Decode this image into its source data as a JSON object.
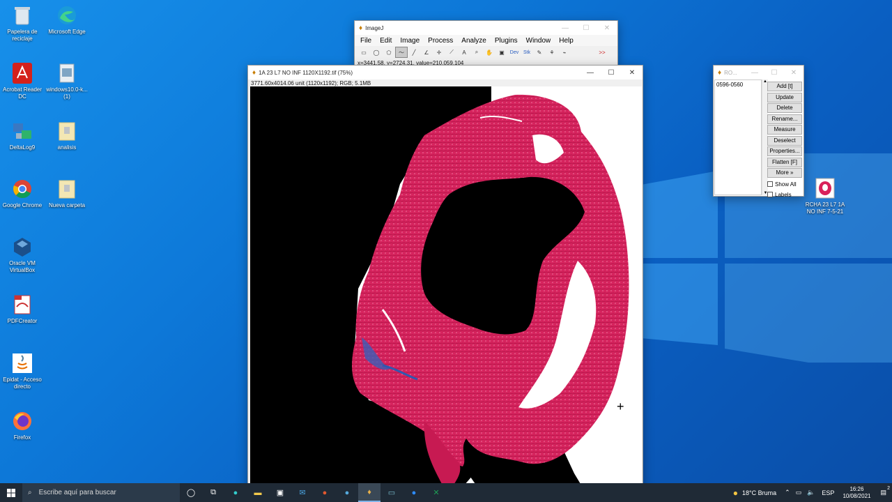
{
  "desktop": {
    "icons": [
      {
        "label": "Papelera de reciclaje",
        "icon": "recycle-bin-icon"
      },
      {
        "label": "Microsoft Edge",
        "icon": "edge-icon"
      },
      {
        "label": "Acrobat Reader DC",
        "icon": "acrobat-icon"
      },
      {
        "label": "windows10.0-k...(1)",
        "icon": "installer-icon"
      },
      {
        "label": "DeltaLog9",
        "icon": "deltalog-icon"
      },
      {
        "label": "analisis",
        "icon": "folder-icon"
      },
      {
        "label": "Google Chrome",
        "icon": "chrome-icon"
      },
      {
        "label": "Nueva carpeta",
        "icon": "folder-icon"
      },
      {
        "label": "Oracle VM VirtualBox",
        "icon": "virtualbox-icon"
      },
      {
        "label": "PDFCreator",
        "icon": "pdfcreator-icon"
      },
      {
        "label": "Epidat - Acceso directo",
        "icon": "java-icon"
      },
      {
        "label": "Firefox",
        "icon": "firefox-icon"
      },
      {
        "label": "RCHA 23 L7 1A NO INF 7-5-21",
        "icon": "tiff-image-icon"
      }
    ]
  },
  "imagej": {
    "title": "ImageJ",
    "menu": [
      "File",
      "Edit",
      "Image",
      "Process",
      "Analyze",
      "Plugins",
      "Window",
      "Help"
    ],
    "tools": [
      "rectangle-tool",
      "oval-tool",
      "polygon-tool",
      "freehand-tool",
      "line-tool",
      "angle-tool",
      "point-tool",
      "wand-tool",
      "text-tool",
      "magnifier-tool",
      "hand-tool",
      "color-picker-tool",
      "Dev",
      "Stk",
      "pencil-tool",
      "brush-tool",
      "flood-fill-tool",
      "more-tools"
    ],
    "tool_labels": {
      "dev": "Dev",
      "stk": "Stk",
      "more": ">>"
    },
    "status": "x=3441.58, y=2724.31, value=210,059,104"
  },
  "image_window": {
    "title": "1A 23 L7 NO INF 1120X1192.tif (75%)",
    "info": "3771.60x4014.06 unit (1120x1192); RGB; 5.1MB"
  },
  "roi_manager": {
    "title": "RO...",
    "list": [
      "0596-0560"
    ],
    "buttons": [
      "Add [t]",
      "Update",
      "Delete",
      "Rename...",
      "Measure",
      "Deselect",
      "Properties...",
      "Flatten [F]",
      "More »"
    ],
    "checks": [
      {
        "label": "Show All",
        "checked": false
      },
      {
        "label": "Labels",
        "checked": false
      }
    ]
  },
  "taskbar": {
    "search_placeholder": "Escribe aquí para buscar",
    "weather": "18°C  Bruma",
    "lang": "ESP",
    "time": "16:26",
    "date": "10/08/2021",
    "notif_count": "2"
  },
  "colors": {
    "tissue": "#d9215a",
    "taskbar": "#1f2a36",
    "desktop": "#0d78d8"
  }
}
